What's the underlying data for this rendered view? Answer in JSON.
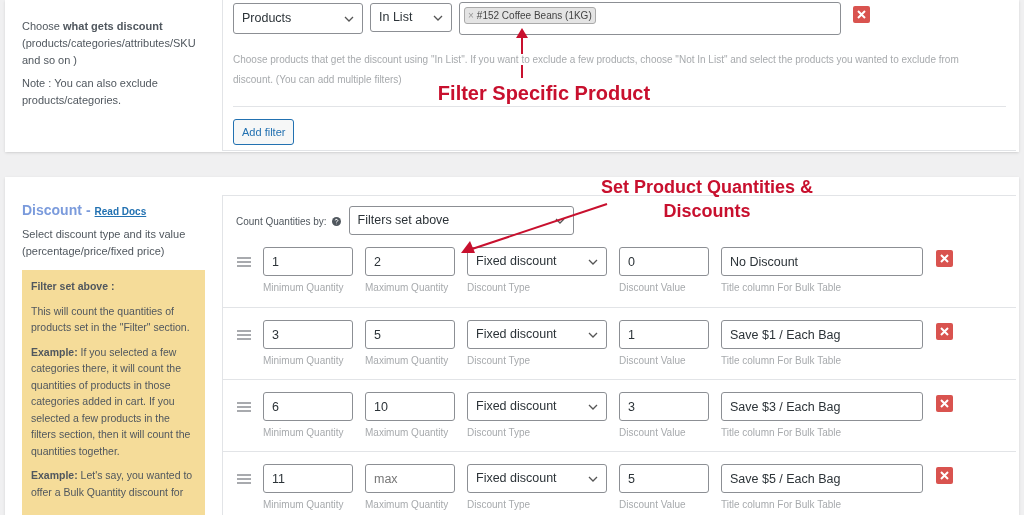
{
  "filter": {
    "description": "Choose **what gets discount** (products/categories/attributes/SKU and so on )",
    "note": "Note : You can also exclude products/categories.",
    "field": "Products",
    "operator": "In List",
    "tags": [
      {
        "remove": "×",
        "label": "#152 Coffee Beans (1KG)"
      }
    ],
    "help": "Choose products that get the discount using \"In List\". If you want to exclude a few products, choose \"Not In List\" and select the products you wanted to exclude from discount. (You can add multiple filters)",
    "add_button": "Add filter"
  },
  "annotations": [
    {
      "kind": "arrow-up",
      "text": "Filter Specific Product"
    },
    {
      "kind": "arrow-left",
      "text": "Set Product Quantities & Discounts"
    }
  ],
  "discount": {
    "title": "Discount",
    "dash": "-",
    "docs_link": "Read Docs",
    "description": "Select discount type and its value (percentage/price/fixed price)",
    "info_box": {
      "heading": "Filter set above :",
      "paragraphs": [
        "This will count the quantities of products set in the \"Filter\" section.",
        "**Example:** If you selected a few categories there, it will count the quantities of products in those categories added in cart. If you selected a few products in the filters section, then it will count the quantities together.",
        "**Example:** Let's say, you wanted to offer a Bulk Quantity discount for"
      ]
    },
    "count_label": "Count Quantities by:",
    "count_value": "Filters set above",
    "rows": [
      {
        "min": "1",
        "max": "2",
        "type": "Fixed discount",
        "value": "0",
        "title": "No Discount",
        "labels": [
          "Minimum Quantity",
          "Maximum Quantity",
          "Discount Type",
          "Discount Value",
          "Title column For Bulk Table"
        ]
      },
      {
        "min": "3",
        "max": "5",
        "type": "Fixed discount",
        "value": "1",
        "title": "Save $1 / Each Bag",
        "labels": [
          "Minimum Quantity",
          "Maximum Quantity",
          "Discount Type",
          "Discount Value",
          "Title column For Bulk Table"
        ]
      },
      {
        "min": "6",
        "max": "10",
        "type": "Fixed discount",
        "value": "3",
        "title": "Save $3 / Each Bag",
        "labels": [
          "Minimum Quantity",
          "Maximum Quantity",
          "Discount Type",
          "Discount Value",
          "Title column For Bulk Table"
        ]
      },
      {
        "min": "11",
        "max_placeholder": "max",
        "type": "Fixed discount",
        "value": "5",
        "title": "Save $5 / Each Bag",
        "labels": [
          "Minimum Quantity",
          "Maximum Quantity",
          "Discount Type",
          "Discount Value",
          "Title column For Bulk Table"
        ]
      }
    ]
  }
}
